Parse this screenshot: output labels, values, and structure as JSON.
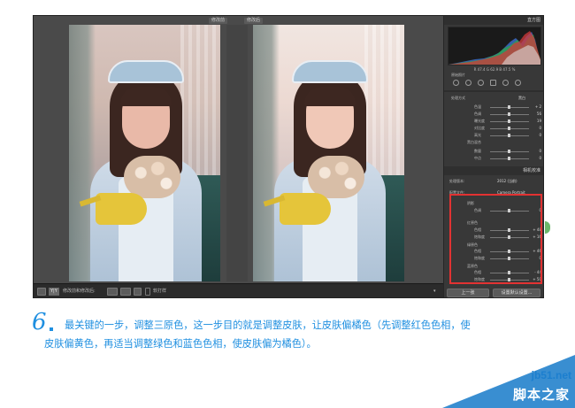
{
  "compare": {
    "before_label": "修改前",
    "after_label": "修改后"
  },
  "toolbar": {
    "mode_label": "修改前和修改后:",
    "softproof_label": "软打样",
    "yy_label": "Y|Y"
  },
  "panel": {
    "histogram_header": "直方图",
    "readout": "R 47.4  G 62.9  B 47.5 %",
    "original_photo_label": "原始照片",
    "basic": {
      "treatment_label": "处理方式",
      "treatment_value": "黑白",
      "profile_label": "配置文件",
      "rows": [
        {
          "label": "色温",
          "value": "+ 2"
        },
        {
          "label": "色调",
          "value": "56"
        },
        {
          "label": "曝光度",
          "value": "19"
        },
        {
          "label": "对比度",
          "value": "0"
        },
        {
          "label": "高光",
          "value": "0"
        }
      ]
    },
    "sub_section_1": "黑白混合",
    "sub_rows_1": [
      {
        "label": "数量",
        "value": "0"
      },
      {
        "label": "中点",
        "value": "0"
      }
    ],
    "camera_header": "相机校准",
    "process_label": "处理版本:",
    "process_value": "2012 (当前)",
    "profile_label": "配置文件:",
    "profile_value": "Camera Portrait",
    "shadows": {
      "title": "阴影",
      "rows": [
        {
          "label": "色调",
          "value": "0"
        }
      ]
    },
    "red": {
      "title": "红原色",
      "rows": [
        {
          "label": "色相",
          "value": "+ 48"
        },
        {
          "label": "饱和度",
          "value": "+ 16"
        }
      ]
    },
    "green": {
      "title": "绿原色",
      "rows": [
        {
          "label": "色相",
          "value": "+ 46"
        },
        {
          "label": "饱和度",
          "value": "0"
        }
      ]
    },
    "blue": {
      "title": "蓝原色",
      "rows": [
        {
          "label": "色相",
          "value": "- 44"
        },
        {
          "label": "饱和度",
          "value": "+ 50"
        }
      ]
    },
    "prev_button": "上一张",
    "reset_button": "设置默认设置..."
  },
  "caption": {
    "step_number": "6",
    "line1": "最关键的一步，调整三原色，这一步目的就是调整皮肤，让皮肤偏橘色（先调整红色色相，使",
    "line2": "皮肤偏黄色，再适当调整绿色和蓝色色相，使皮肤偏为橘色）。"
  },
  "watermark": {
    "url": "jb51.net",
    "name": "脚本之家"
  },
  "colors": {
    "accent": "#1f8fe0",
    "highlight": "#e23232",
    "watermark": "#2e88cf"
  }
}
